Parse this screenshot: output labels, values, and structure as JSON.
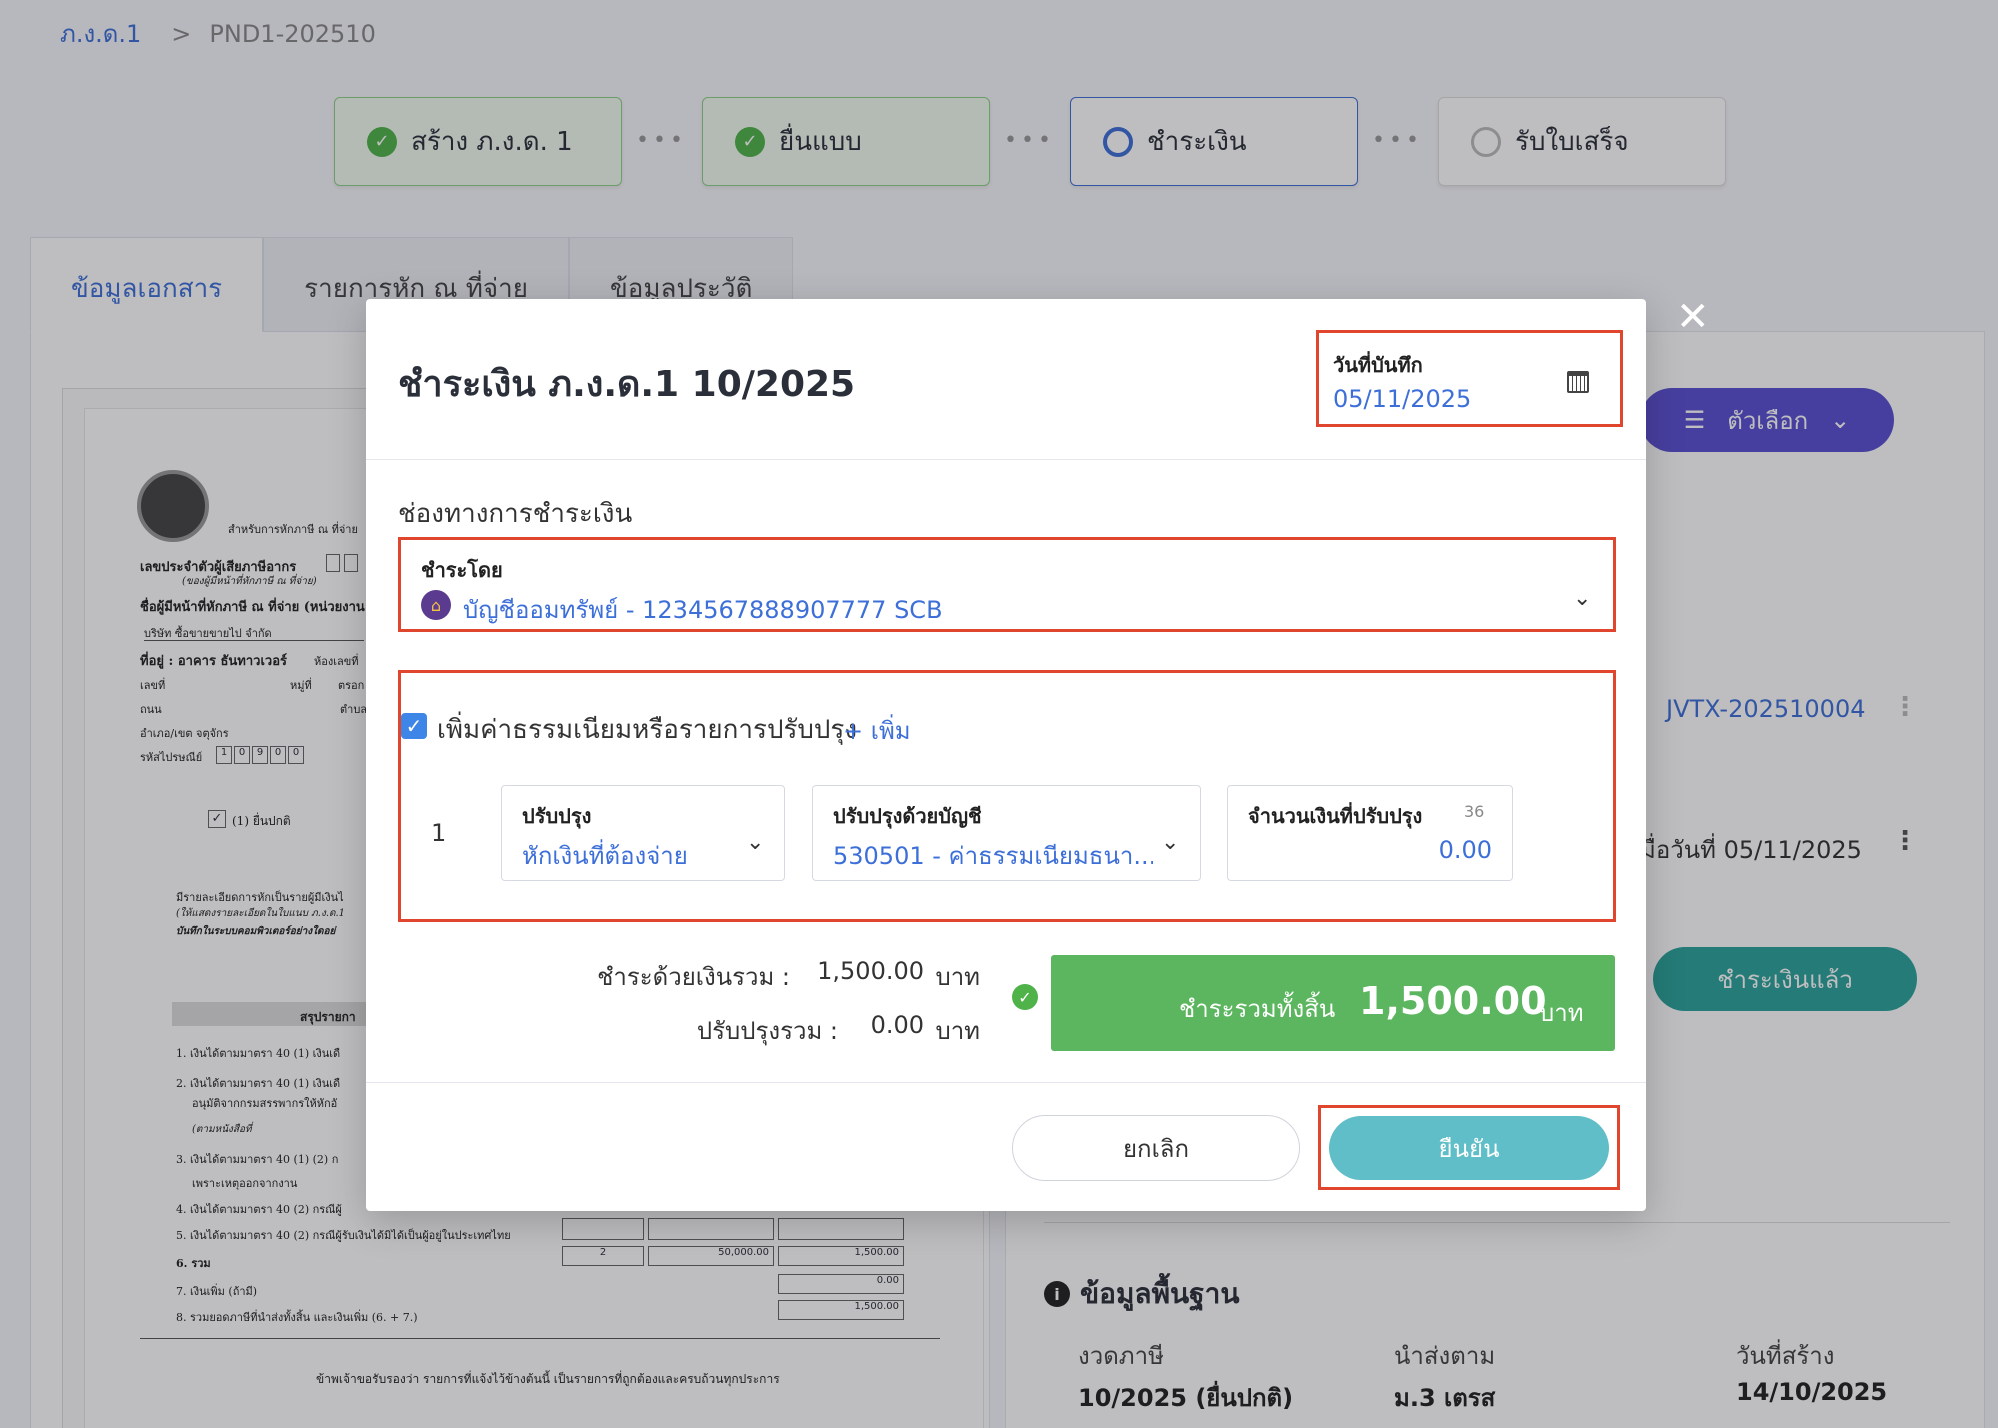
{
  "breadcrumb": {
    "root": "ภ.ง.ด.1",
    "separator": ">",
    "current": "PND1-202510"
  },
  "steps": [
    {
      "label": "สร้าง ภ.ง.ด. 1",
      "state": "done"
    },
    {
      "label": "ยื่นแบบ",
      "state": "done"
    },
    {
      "label": "ชำระเงิน",
      "state": "active"
    },
    {
      "label": "รับใบเสร็จ",
      "state": "todo"
    }
  ],
  "tabs": [
    "ข้อมูลเอกสาร",
    "รายการหัก ณ ที่จ่าย",
    "ข้อมูลประวัติ"
  ],
  "document": {
    "header_note": "สำหรับการหักภาษี ณ ที่จ่าย",
    "tax_id_label": "เลขประจำตัวผู้เสียภาษีอากร",
    "tax_id_sub": "(ของผู้มีหน้าที่หักภาษี ณ ที่จ่าย)",
    "payer_label": "ชื่อผู้มีหน้าที่หักภาษี ณ ที่จ่าย (หน่วยงาน",
    "company": "บริษัท ซื้อขายขายไป จำกัด",
    "address_label": "ที่อยู่ : อาคาร ธันทาวเวอร์",
    "room": "ห้องเลขที่",
    "no": "เลขที่",
    "moo": "หมู่ที่",
    "alley": "ตรอก",
    "road": "ถนน",
    "subdistrict": "ตำบล",
    "district": "อำเภอ/เขต จตุจักร",
    "postcode_label": "รหัสไปรษณีย์",
    "postcode": [
      "1",
      "0",
      "9",
      "0",
      "0"
    ],
    "filing_normal": "(1) ยื่นปกติ",
    "detail_text_1": "มีรายละเอียดการหักเป็นรายผู้มีเงินไ",
    "detail_text_2": "(ให้แสดงรายละเอียดในใบแนบ ภ.ง.ด.1",
    "detail_text_3": "บันทึกในระบบคอมพิวเตอร์อย่างใดอย่",
    "summary_title": "สรุปรายกา",
    "lines": [
      "1. เงินได้ตามมาตรา 40 (1) เงินเดื",
      "2. เงินได้ตามมาตรา 40 (1) เงินเดื",
      "อนุมัติจากกรมสรรพากรให้หักอั",
      "(ตามหนังสือที่",
      "3. เงินได้ตามมาตรา 40 (1) (2) ก",
      "เพราะเหตุออกจากงาน",
      "4. เงินได้ตามมาตรา 40 (2) กรณีผู้",
      "5. เงินได้ตามมาตรา 40 (2) กรณีผู้รับเงินได้มิได้เป็นผู้อยู่ในประเทศไทย",
      "6. รวม",
      "7. เงินเพิ่ม (ถ้ามี)",
      "8. รวมยอดภาษีที่นำส่งทั้งสิ้น และเงินเพิ่ม (6. + 7.)"
    ],
    "totals": {
      "count": "2",
      "income": "50,000.00",
      "tax": "1,500.00",
      "surcharge": "0.00",
      "grand": "1,500.00"
    },
    "certify": "ข้าพเจ้าขอรับรองว่า รายการที่แจ้งไว้ข้างต้นนี้ เป็นรายการที่ถูกต้องและครบถ้วนทุกประการ"
  },
  "right_panel": {
    "options_label": "ตัวเลือก",
    "jv_link": "JVTX-202510004",
    "paid_on": "มื่อวันที่ 05/11/2025",
    "paid_button": "ชำระเงินแล้ว",
    "info_title": "ข้อมูลพื้นฐาน",
    "fields": [
      {
        "label": "งวดภาษี",
        "value": "10/2025 (ยื่นปกติ)"
      },
      {
        "label": "นำส่งตาม",
        "value": "ม.3 เตรส"
      },
      {
        "label": "วันที่สร้าง",
        "value": "14/10/2025"
      }
    ]
  },
  "modal": {
    "title": "ชำระเงิน ภ.ง.ด.1 10/2025",
    "record_date_label": "วันที่บันทึก",
    "record_date": "05/11/2025",
    "channel_label": "ช่องทางการชำระเงิน",
    "pay_by_label": "ชำระโดย",
    "pay_by_value": "บัญชีออมทรัพย์ - 1234567888907777 SCB",
    "adjust_checkbox_label": "เพิ่มค่าธรรมเนียมหรือรายการปรับปรุง",
    "add_link": "+ เพิ่ม",
    "adjust_rows": [
      {
        "no": "1",
        "adjust_label": "ปรับปรุง",
        "adjust_value": "หักเงินที่ต้องจ่าย",
        "account_label": "ปรับปรุงด้วยบัญชี",
        "account_value": "530501 - ค่าธรรมเนียมธนา...",
        "amount_label": "จำนวนเงินที่ปรับปรุง",
        "amount_counter": "36",
        "amount_value": "0.00"
      }
    ],
    "pay_total_label": "ชำระด้วยเงินรวม :",
    "pay_total_value": "1,500.00",
    "adjust_total_label": "ปรับปรุงรวม :",
    "adjust_total_value": "0.00",
    "currency": "บาท",
    "grand_total_label": "ชำระรวมทั้งสิ้น",
    "grand_total_value": "1,500.00",
    "cancel_label": "ยกเลิก",
    "confirm_label": "ยืนยัน"
  },
  "colors": {
    "accent": "#3d6fd8",
    "highlight": "#e0452d",
    "success": "#5bb65f",
    "confirm": "#5fbec8",
    "options": "#5a4fd1"
  }
}
